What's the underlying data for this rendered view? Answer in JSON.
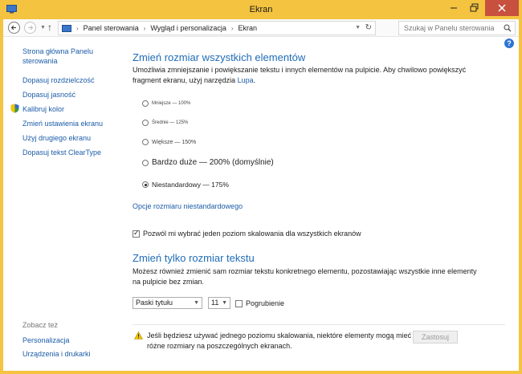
{
  "window": {
    "title": "Ekran"
  },
  "address": {
    "crumbs": [
      "Panel sterowania",
      "Wygląd i personalizacja",
      "Ekran"
    ],
    "search_placeholder": "Szukaj w Panelu sterowania"
  },
  "sidebar": {
    "items": [
      {
        "label": "Strona główna Panelu sterowania"
      },
      {
        "label": "Dopasuj rozdzielczość"
      },
      {
        "label": "Dopasuj jasność"
      },
      {
        "label": "Kalibruj kolor"
      },
      {
        "label": "Zmień ustawienia ekranu"
      },
      {
        "label": "Użyj drugiego ekranu"
      },
      {
        "label": "Dopasuj tekst ClearType"
      }
    ],
    "see_also_heading": "Zobacz też",
    "see_also": [
      {
        "label": "Personalizacja"
      },
      {
        "label": "Urządzenia i drukarki"
      }
    ]
  },
  "main": {
    "section1": {
      "heading": "Zmień rozmiar wszystkich elementów",
      "desc_prefix": "Umożliwia zmniejszanie i powiększanie tekstu i innych elementów na pulpicie. Aby chwilowo powiększyć fragment ekranu, użyj narzędzia ",
      "desc_link": "Lupa",
      "desc_suffix": "."
    },
    "options": [
      {
        "label": "Mniejsze — 100%",
        "checked": false
      },
      {
        "label": "Średnie — 125%",
        "checked": false
      },
      {
        "label": "Większe — 150%",
        "checked": false
      },
      {
        "label": "Bardzo duże — 200% (domyślnie)",
        "checked": false
      },
      {
        "label": "Niestandardowy — 175%",
        "checked": true
      }
    ],
    "custom_link": "Opcje rozmiaru niestandardowego",
    "single_scale": {
      "label": "Pozwól mi wybrać jeden poziom skalowania dla wszystkich ekranów",
      "checked": true
    },
    "section2": {
      "heading": "Zmień tylko rozmiar tekstu",
      "desc": "Możesz również zmienić sam rozmiar tekstu konkretnego elementu, pozostawiając wszystkie inne elementy na pulpicie bez zmian."
    },
    "element_select": "Paski tytułu",
    "size_select": "11",
    "bold": {
      "label": "Pogrubienie",
      "checked": false
    },
    "notice": "Jeśli będziesz używać jednego poziomu skalowania, niektóre elementy mogą mieć różne rozmiary na poszczególnych ekranach.",
    "apply_label": "Zastosuj"
  },
  "colors": {
    "frame": "#f4c340",
    "link": "#1c5ca8",
    "heading": "#1f6cb7",
    "close": "#c7503e"
  }
}
